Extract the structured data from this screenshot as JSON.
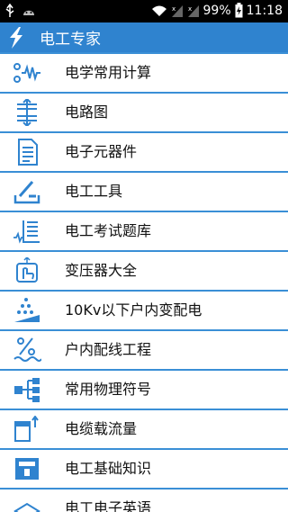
{
  "status": {
    "battery": "99%",
    "time": "11:18"
  },
  "app": {
    "title": "电工专家"
  },
  "menu": [
    {
      "label": "电学常用计算",
      "icon": "waveform-icon"
    },
    {
      "label": "电路图",
      "icon": "circuit-diagram-icon"
    },
    {
      "label": "电子元器件",
      "icon": "document-icon"
    },
    {
      "label": "电工工具",
      "icon": "tools-icon"
    },
    {
      "label": "电工考试题库",
      "icon": "exam-bank-icon"
    },
    {
      "label": "变压器大全",
      "icon": "hand-touch-icon"
    },
    {
      "label": "10Kv以下户内变配电",
      "icon": "distribution-icon"
    },
    {
      "label": "户内配线工程",
      "icon": "percent-wiring-icon"
    },
    {
      "label": "常用物理符号",
      "icon": "network-symbol-icon"
    },
    {
      "label": "电缆载流量",
      "icon": "cable-icon"
    },
    {
      "label": "电工基础知识",
      "icon": "basics-card-icon"
    },
    {
      "label": "电工电子英语",
      "icon": "english-book-icon"
    }
  ],
  "colors": {
    "accent": "#2f83cf",
    "separator": "#3a8fd6"
  }
}
